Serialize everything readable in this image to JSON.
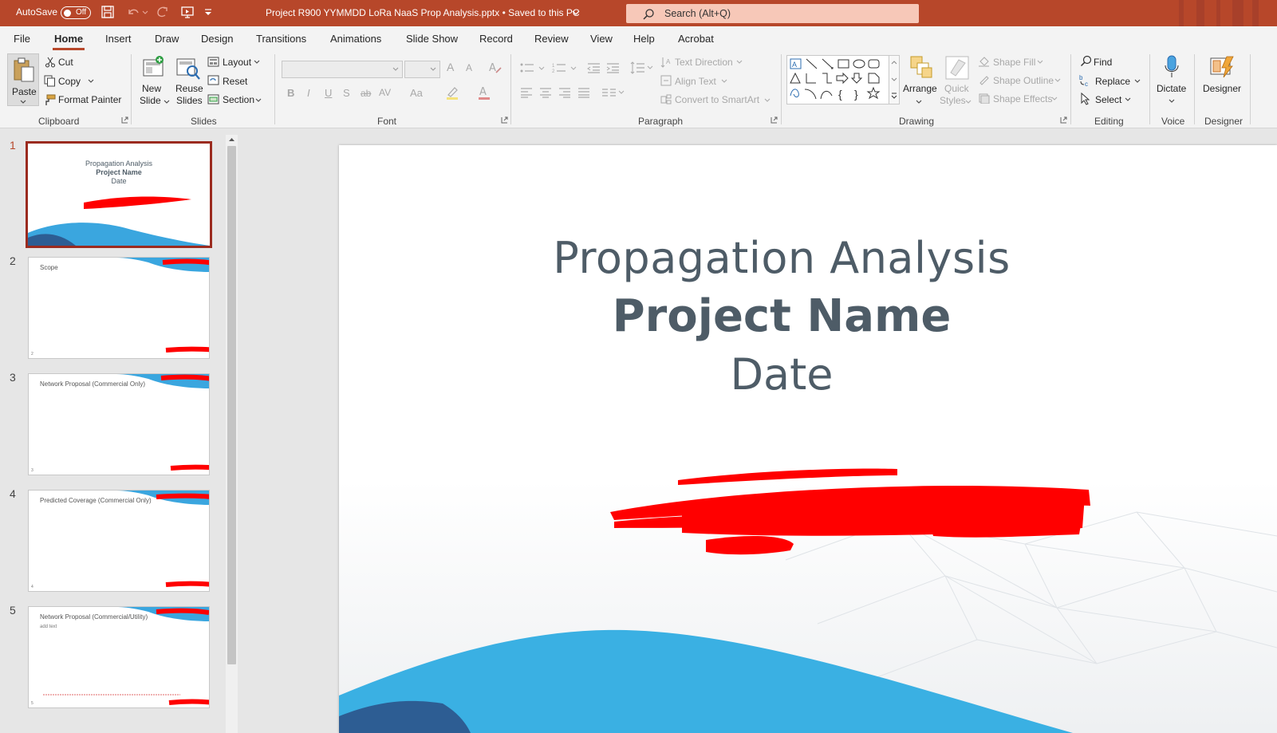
{
  "titlebar": {
    "autosave_label": "AutoSave",
    "autosave_state": "Off",
    "doc_title": "Project R900 YYMMDD LoRa NaaS Prop Analysis.pptx  •  Saved to this PC",
    "search_placeholder": "Search (Alt+Q)",
    "accent_color": "#b7472a"
  },
  "tabs": [
    {
      "label": "File"
    },
    {
      "label": "Home"
    },
    {
      "label": "Insert"
    },
    {
      "label": "Draw"
    },
    {
      "label": "Design"
    },
    {
      "label": "Transitions"
    },
    {
      "label": "Animations"
    },
    {
      "label": "Slide Show"
    },
    {
      "label": "Record"
    },
    {
      "label": "Review"
    },
    {
      "label": "View"
    },
    {
      "label": "Help"
    },
    {
      "label": "Acrobat"
    }
  ],
  "ribbon": {
    "clipboard": {
      "paste": "Paste",
      "cut": "Cut",
      "copy": "Copy",
      "format_painter": "Format Painter",
      "label": "Clipboard"
    },
    "slides": {
      "new_slide_1": "New",
      "new_slide_2": "Slide",
      "reuse_1": "Reuse",
      "reuse_2": "Slides",
      "layout": "Layout",
      "reset": "Reset",
      "section": "Section",
      "label": "Slides"
    },
    "font": {
      "label": "Font",
      "bold": "B",
      "italic": "I",
      "underline": "U",
      "shadow": "S",
      "strike": "ab",
      "spacing": "AV",
      "case": "Aa",
      "grow": "A",
      "shrink": "A"
    },
    "paragraph": {
      "label": "Paragraph",
      "text_direction": "Text Direction",
      "align_text": "Align Text",
      "convert_smartart": "Convert to SmartArt"
    },
    "drawing": {
      "label": "Drawing",
      "arrange": "Arrange",
      "quick_styles_1": "Quick",
      "quick_styles_2": "Styles",
      "shape_fill": "Shape Fill",
      "shape_outline": "Shape Outline",
      "shape_effects": "Shape Effects"
    },
    "editing": {
      "label": "Editing",
      "find": "Find",
      "replace": "Replace",
      "select": "Select"
    },
    "voice": {
      "label": "Voice",
      "dictate": "Dictate"
    },
    "designer": {
      "label": "Designer",
      "designer": "Designer"
    }
  },
  "slides": [
    {
      "num": "1",
      "title_l1": "Propagation Analysis",
      "title_l2": "Project Name",
      "title_l3": "Date"
    },
    {
      "num": "2",
      "title": "Scope",
      "footer": "2"
    },
    {
      "num": "3",
      "title": "Network Proposal (Commercial Only)",
      "footer": "3"
    },
    {
      "num": "4",
      "title": "Predicted Coverage (Commercial Only)",
      "footer": "4"
    },
    {
      "num": "5",
      "title": "Network Proposal (Commercial/Utility)",
      "body": "add text",
      "footer": "5"
    }
  ],
  "main_slide": {
    "line1": "Propagation Analysis",
    "line2": "Project Name",
    "line3": "Date"
  }
}
